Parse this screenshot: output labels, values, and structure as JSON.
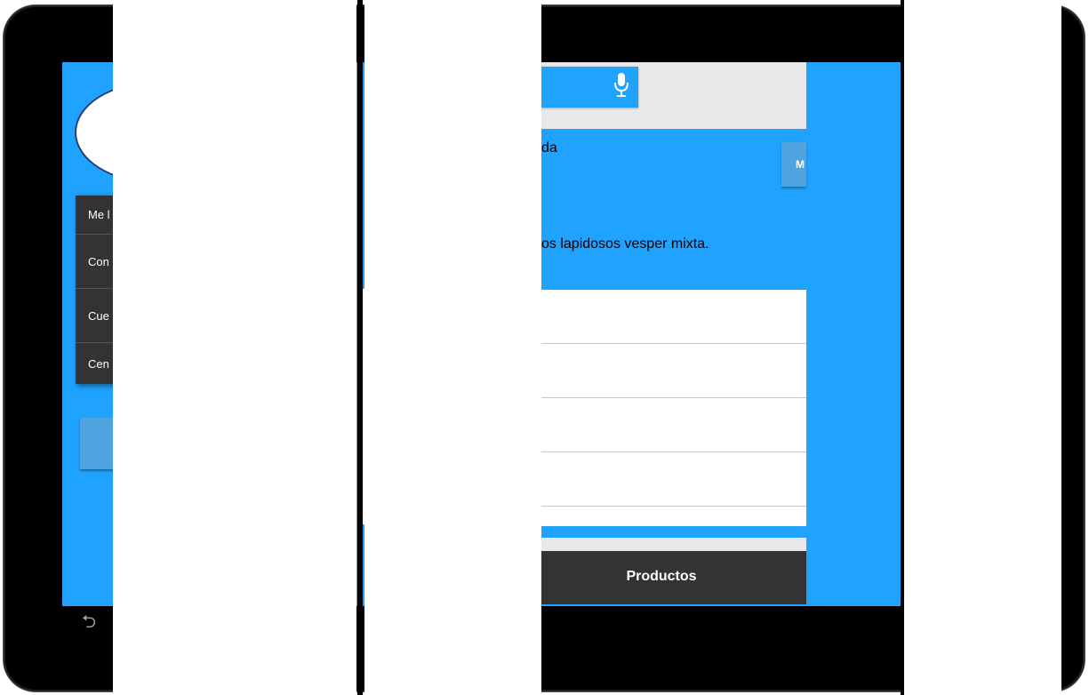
{
  "left_menu": {
    "items": [
      "Me l",
      "Con",
      "Cue",
      "Cen"
    ]
  },
  "search": {
    "mic_icon": "microphone-icon"
  },
  "content": {
    "partial_title": "da",
    "description": "os lapidosos vesper mixta.",
    "button_label": "M"
  },
  "list": {
    "rows": [
      "",
      "",
      "",
      ""
    ]
  },
  "bottom_tab": {
    "label": "Productos"
  },
  "nav": {
    "back_icon": "back-icon"
  },
  "colors": {
    "accent": "#1fa3ff",
    "menu_bg": "#333333",
    "button": "#4fa3e0"
  }
}
